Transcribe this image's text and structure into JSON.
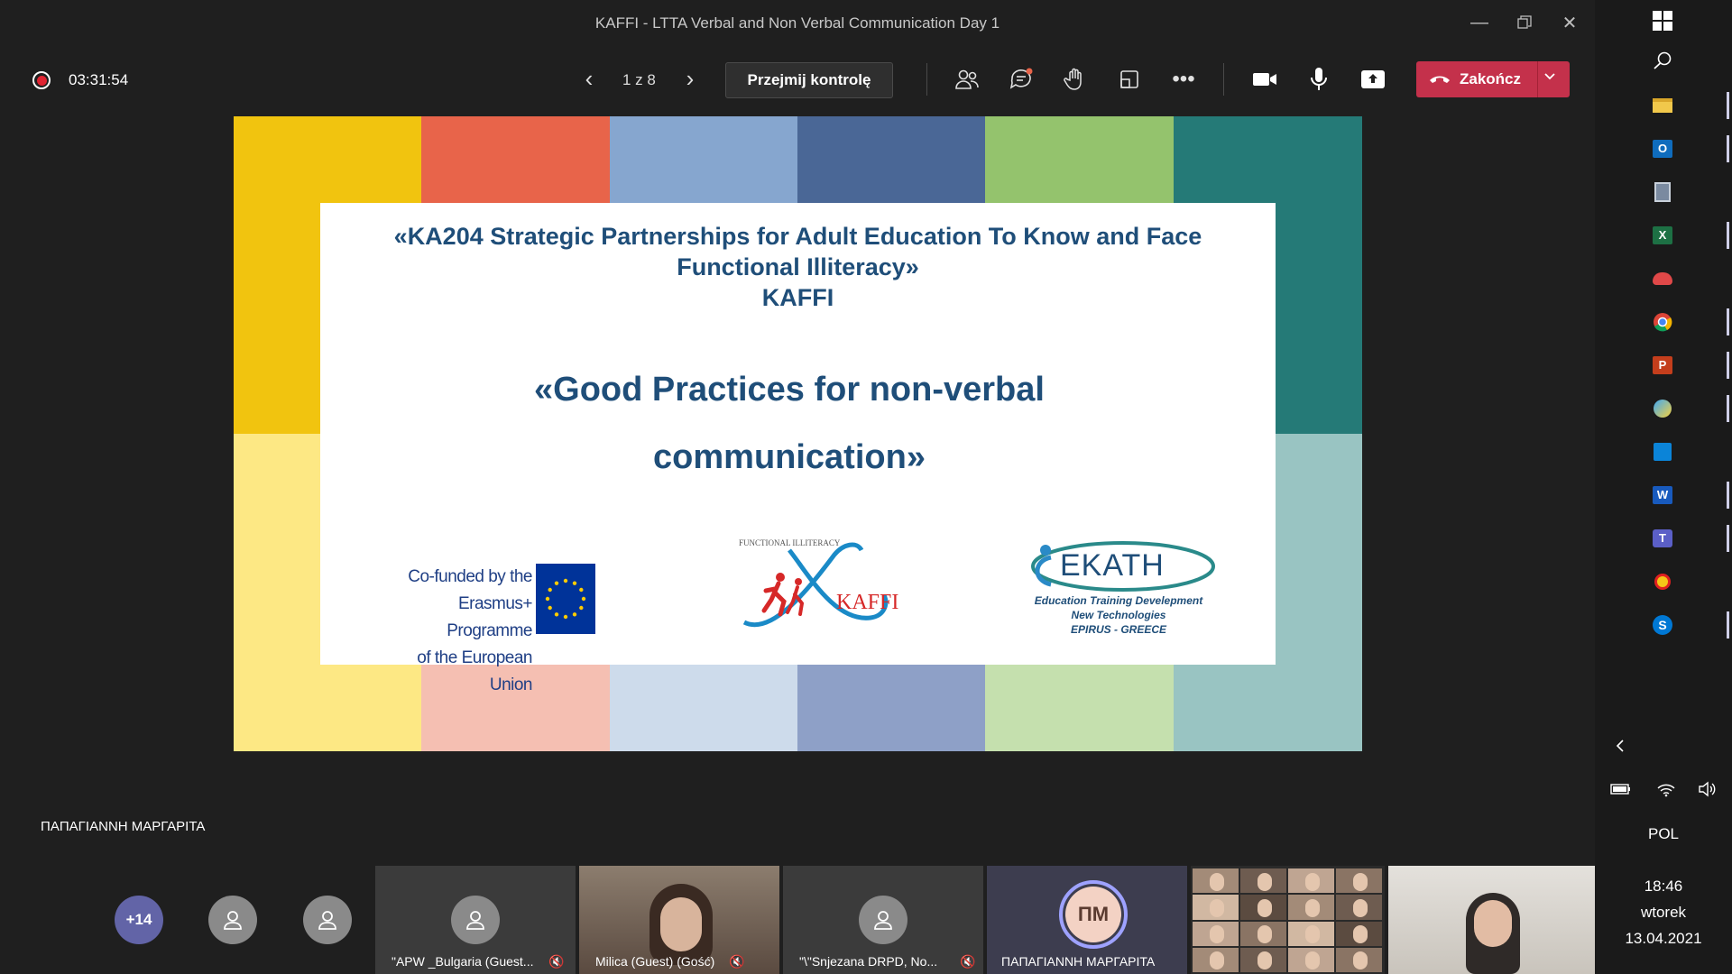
{
  "window": {
    "title": "KAFFI - LTTA Verbal and Non Verbal Communication Day 1"
  },
  "toolbar": {
    "timer": "03:31:54",
    "page_indicator": "1 z 8",
    "take_control_label": "Przejmij kontrolę",
    "end_call_label": "Zakończ"
  },
  "slide": {
    "title_line1": "«KA204 Strategic Partnerships for Adult Education To Know and Face",
    "title_line2": "Functional Illiteracy»",
    "title_line3": "KAFFI",
    "subtitle": "«Good Practices for non-verbal communication»",
    "eu_logo_text": [
      "Co-funded by the",
      "Erasmus+ Programme",
      "of the European Union"
    ],
    "kaffi_logo": {
      "top_text": "FUNCTIONAL ILLITERACY",
      "name": "KAFFI"
    },
    "ekath_logo": {
      "name": "EKATH",
      "line1": "Education Training Develepment",
      "line2": "New Technologies",
      "line3": "EPIRUS - GREECE"
    },
    "band_colors_top": [
      "#f1c40f",
      "#e8644a",
      "#86a6cf",
      "#4a6796",
      "#94c36d",
      "#257a77"
    ],
    "band_colors_bottom": [
      "#fde884",
      "#f5bfb2",
      "#cddbeb",
      "#8ea0c7",
      "#c5e0ae",
      "#99c4c2"
    ]
  },
  "presenter_name": "ΠΑΠΑΓΙΑΝΝΗ ΜΑΡΓΑΡΙΤΑ",
  "gallery": {
    "overflow_count": "+14",
    "tiles": [
      {
        "name": "\"APW _Bulgaria (Guest..."
      },
      {
        "name": "Milica (Guest) (Gość)"
      },
      {
        "name": "\"\\\"Snjezana DRPD, No..."
      },
      {
        "name": "ΠΑΠΑΓΙΑΝΝΗ ΜΑΡΓΑΡΙΤΑ",
        "initials": "ΠΜ"
      }
    ]
  },
  "taskbar": {
    "language": "POL",
    "time": "18:46",
    "day": "wtorek",
    "date": "13.04.2021"
  },
  "colors": {
    "end_call": "#c4314b",
    "accent": "#6264a7",
    "slide_text": "#1f4e79"
  }
}
